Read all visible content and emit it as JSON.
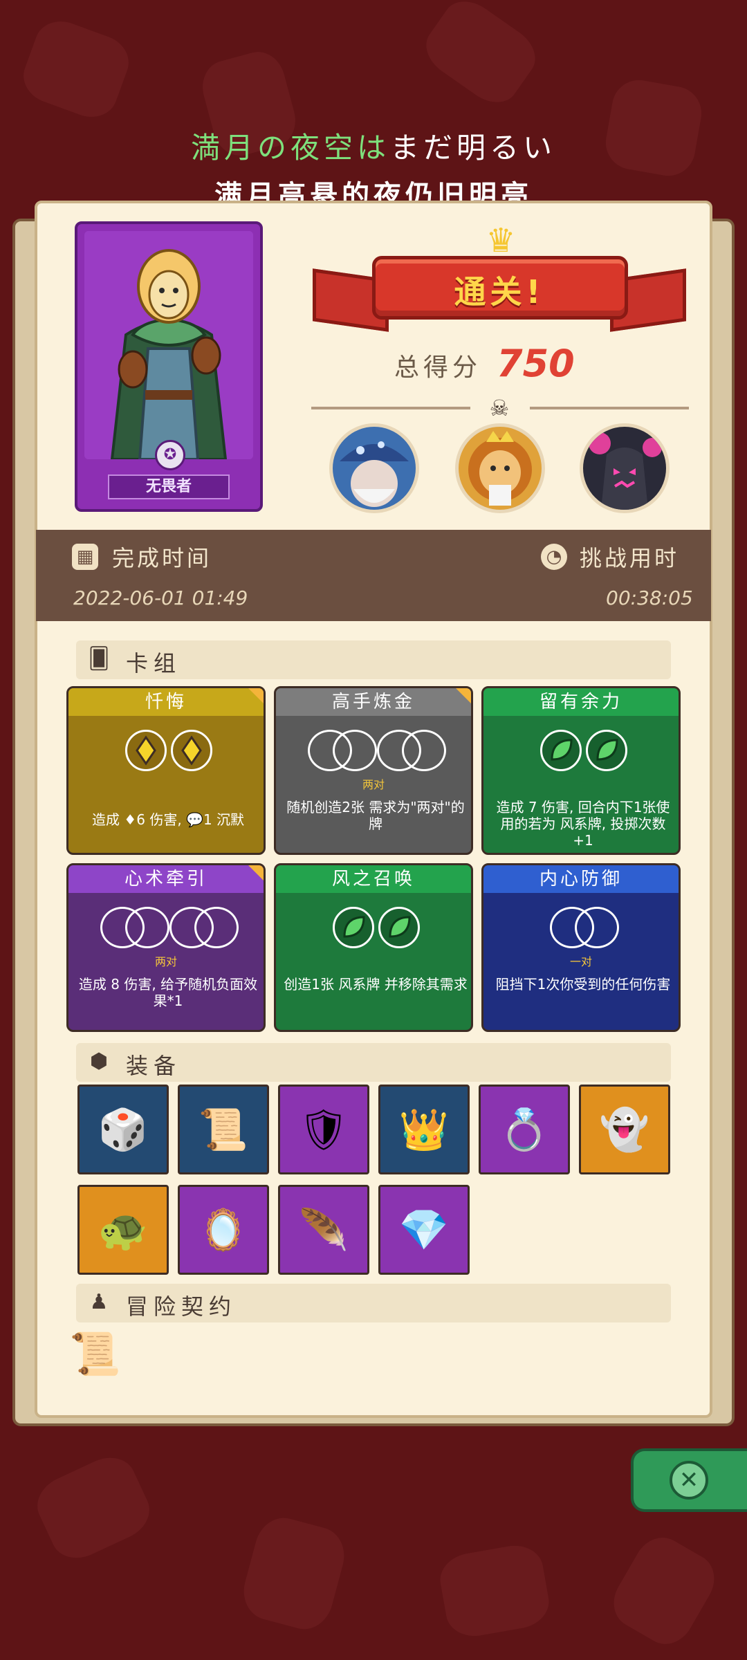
{
  "header": {
    "jp_parts": [
      "満月の夜空は",
      "まだ明るい"
    ],
    "cn": "满月高悬的夜仍旧明亮"
  },
  "hero": {
    "name": "无畏者"
  },
  "result": {
    "banner": "通关!",
    "score_label": "总得分",
    "score_value": "750"
  },
  "time": {
    "finish_label": "完成时间",
    "finish_value": "2022-06-01 01:49",
    "challenge_label": "挑战用时",
    "challenge_value": "00:38:05"
  },
  "deck": {
    "title": "卡组",
    "cards": [
      {
        "name": "忏悔",
        "color": "#b7950f",
        "head": "#c7a81a",
        "cost": "diamond-pair",
        "sub": "",
        "desc": "造成 ♦6 伤害, 💬1 沉默"
      },
      {
        "name": "高手炼金",
        "color": "#5a5a5a",
        "head": "#7d7d7d",
        "cost": "double-pair",
        "sub": "两对",
        "desc": "随机创造2张 需求为\"两对\"的牌"
      },
      {
        "name": "留有余力",
        "color": "#1e7a3c",
        "head": "#23a34d",
        "cost": "leaf-pair",
        "sub": "",
        "desc": "造成 7 伤害, 回合内下1张使用的若为 风系牌, 投掷次数+1"
      },
      {
        "name": "心术牵引",
        "color": "#5a2e78",
        "head": "#8e45c8",
        "cost": "double-pair",
        "sub": "两对",
        "desc": "造成 8 伤害, 给予随机负面效果*1"
      },
      {
        "name": "风之召唤",
        "color": "#1e7a3c",
        "head": "#23a34d",
        "cost": "leaf-pair",
        "sub": "",
        "desc": "创造1张 风系牌 并移除其需求"
      },
      {
        "name": "内心防御",
        "color": "#1f2e80",
        "head": "#2f5fd0",
        "cost": "pair",
        "sub": "一对",
        "desc": "阻挡下1次你受到的任何伤害"
      }
    ]
  },
  "equipment": {
    "title": "装备",
    "items": [
      {
        "icon": "dice-box-icon",
        "glyph": "🎲",
        "bg": "#234a72"
      },
      {
        "icon": "scroll-icon",
        "glyph": "📜",
        "bg": "#234a72"
      },
      {
        "icon": "shield-icon",
        "glyph": "🛡",
        "bg": "#8a34b0"
      },
      {
        "icon": "crown-icon",
        "glyph": "👑",
        "bg": "#234a72"
      },
      {
        "icon": "ring-icon",
        "glyph": "💍",
        "bg": "#8a34b0"
      },
      {
        "icon": "ghost-icon",
        "glyph": "👻",
        "bg": "#e0901e"
      },
      {
        "icon": "turtle-shell-icon",
        "glyph": "🐢",
        "bg": "#e0901e"
      },
      {
        "icon": "mirror-icon",
        "glyph": "🪞",
        "bg": "#8a34b0"
      },
      {
        "icon": "feather-icon",
        "glyph": "🪶",
        "bg": "#8a34b0"
      },
      {
        "icon": "necklace-icon",
        "glyph": "💎",
        "bg": "#8a34b0"
      }
    ]
  },
  "contract": {
    "title": "冒险契约"
  }
}
